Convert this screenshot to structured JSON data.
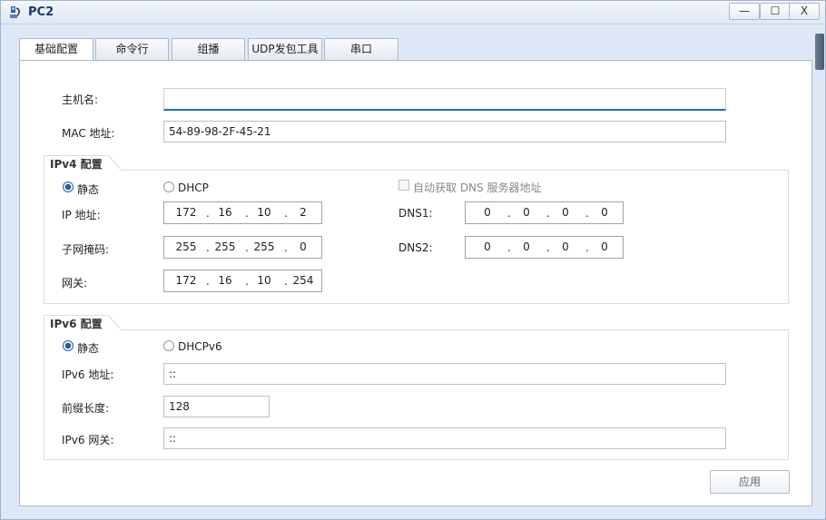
{
  "window": {
    "title": "PC2",
    "min_label": "—",
    "max_label": "☐",
    "close_label": "X"
  },
  "tabs": [
    {
      "label": "基础配置",
      "active": true
    },
    {
      "label": "命令行",
      "active": false
    },
    {
      "label": "组播",
      "active": false
    },
    {
      "label": "UDP发包工具",
      "active": false
    },
    {
      "label": "串口",
      "active": false
    }
  ],
  "basic": {
    "hostname_label": "主机名:",
    "hostname_value": "",
    "mac_label": "MAC 地址:",
    "mac_value": "54-89-98-2F-45-21"
  },
  "ipv4": {
    "section_title": "IPv4 配置",
    "static_label": "静态",
    "dhcp_label": "DHCP",
    "auto_dns_label": "自动获取 DNS 服务器地址",
    "ip_label": "IP 地址:",
    "ip": [
      "172",
      "16",
      "10",
      "2"
    ],
    "mask_label": "子网掩码:",
    "mask": [
      "255",
      "255",
      "255",
      "0"
    ],
    "gateway_label": "网关:",
    "gateway": [
      "172",
      "16",
      "10",
      "254"
    ],
    "dns1_label": "DNS1:",
    "dns1": [
      "0",
      "0",
      "0",
      "0"
    ],
    "dns2_label": "DNS2:",
    "dns2": [
      "0",
      "0",
      "0",
      "0"
    ],
    "dot": "."
  },
  "ipv6": {
    "section_title": "IPv6 配置",
    "static_label": "静态",
    "dhcp_label": "DHCPv6",
    "addr_label": "IPv6 地址:",
    "addr_value": "::",
    "prefix_label": "前缀长度:",
    "prefix_value": "128",
    "gateway_label": "IPv6 网关:",
    "gateway_value": "::"
  },
  "footer": {
    "apply_label": "应用"
  }
}
